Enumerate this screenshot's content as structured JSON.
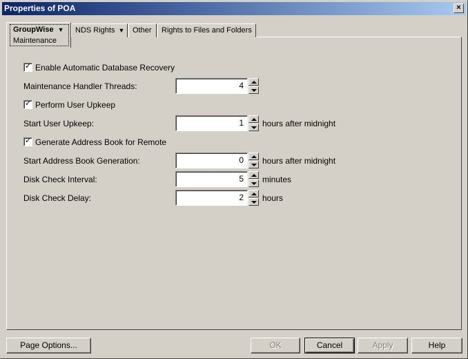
{
  "window": {
    "title": "Properties of POA",
    "close_label": "×"
  },
  "tabs": {
    "active": {
      "label": "GroupWise",
      "sublabel": "Maintenance"
    },
    "others": [
      {
        "label": "NDS Rights",
        "has_dropdown": true
      },
      {
        "label": "Other",
        "has_dropdown": false
      },
      {
        "label": "Rights to Files and Folders",
        "has_dropdown": false
      }
    ]
  },
  "settings": {
    "enable_recovery": {
      "label": "Enable Automatic Database Recovery",
      "checked": true
    },
    "handler_threads": {
      "label": "Maintenance Handler Threads:",
      "value": "4"
    },
    "perform_upkeep": {
      "label": "Perform User Upkeep",
      "checked": true
    },
    "start_upkeep": {
      "label": "Start User Upkeep:",
      "value": "1",
      "suffix": "hours after midnight"
    },
    "generate_address_book": {
      "label": "Generate Address Book for Remote",
      "checked": true
    },
    "start_address_book": {
      "label": "Start Address Book Generation:",
      "value": "0",
      "suffix": "hours after midnight"
    },
    "disk_check_interval": {
      "label": "Disk Check Interval:",
      "value": "5",
      "suffix": "minutes"
    },
    "disk_check_delay": {
      "label": "Disk Check Delay:",
      "value": "2",
      "suffix": "hours"
    }
  },
  "buttons": {
    "page_options": {
      "label": "Page Options...",
      "enabled": true
    },
    "ok": {
      "label": "OK",
      "enabled": false
    },
    "cancel": {
      "label": "Cancel",
      "enabled": true
    },
    "apply": {
      "label": "Apply",
      "enabled": false
    },
    "help": {
      "label": "Help",
      "enabled": true
    }
  },
  "icons": {
    "checkmark": "check-icon",
    "dropdown": "dropdown-arrow-icon",
    "spin_up": "spin-up-icon",
    "spin_down": "spin-down-icon"
  },
  "colors": {
    "face": "#d4d0c8",
    "title_start": "#0a246a",
    "title_end": "#a6caf0",
    "disabled_text": "#808080"
  }
}
